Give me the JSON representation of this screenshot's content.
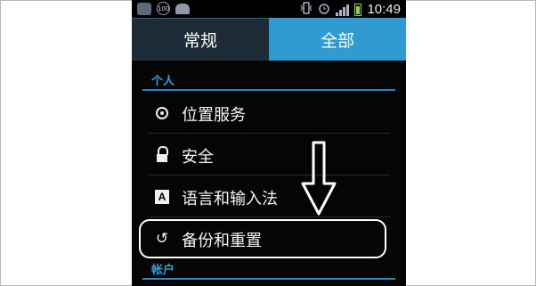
{
  "status_bar": {
    "time": "10:49",
    "notification_badge": "100",
    "icons": [
      "app-icon",
      "badge-icon",
      "android-icon",
      "vibrate-icon",
      "alarm-icon",
      "signal-icon",
      "battery-icon"
    ]
  },
  "tabs": [
    {
      "label": "常规",
      "selected": false
    },
    {
      "label": "全部",
      "selected": true
    }
  ],
  "sections": [
    {
      "label": "个人"
    },
    {
      "label": "帐户"
    }
  ],
  "items": [
    {
      "label": "位置服务",
      "icon": "location-icon"
    },
    {
      "label": "安全",
      "icon": "lock-icon"
    },
    {
      "label": "语言和输入法",
      "icon": "language-icon"
    },
    {
      "label": "备份和重置",
      "icon": "backup-restore-icon"
    }
  ],
  "annotation": {
    "shape": "ellipse",
    "target": "备份和重置",
    "arrow": "down"
  },
  "colors": {
    "accent": "#2f9bd0",
    "section_text": "#3a9dd5",
    "background": "#050505"
  }
}
